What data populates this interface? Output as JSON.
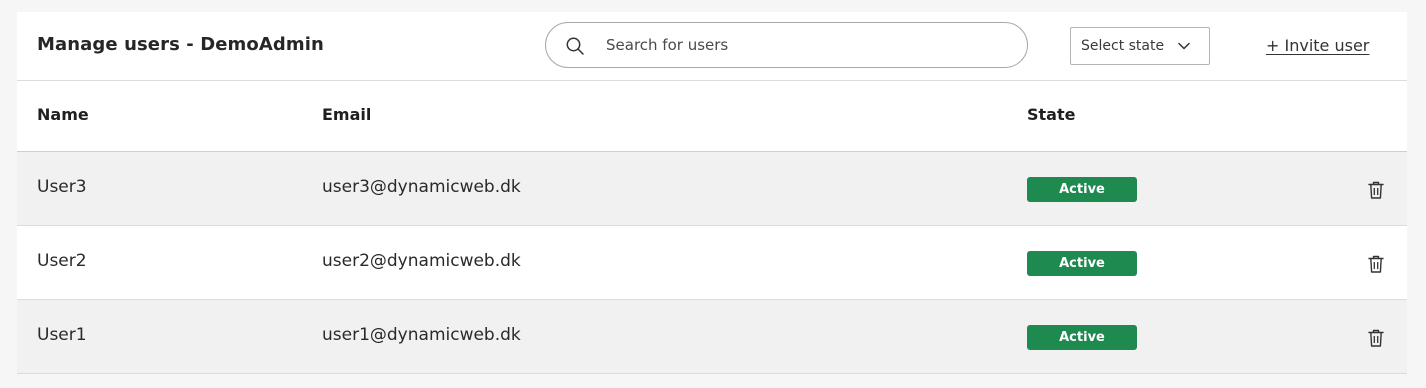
{
  "header": {
    "title": "Manage users - DemoAdmin",
    "search": {
      "placeholder": "Search for users",
      "value": ""
    },
    "state_select": {
      "label": "Select state"
    },
    "invite_label": "+ Invite user"
  },
  "table": {
    "columns": [
      "Name",
      "Email",
      "State"
    ],
    "rows": [
      {
        "name": "User3",
        "email": "user3@dynamicweb.dk",
        "state": "Active"
      },
      {
        "name": "User2",
        "email": "user2@dynamicweb.dk",
        "state": "Active"
      },
      {
        "name": "User1",
        "email": "user1@dynamicweb.dk",
        "state": "Active"
      }
    ]
  },
  "colors": {
    "active_badge": "#1e8a50",
    "row_shade": "#f1f1f1",
    "background": "#f6f6f6"
  },
  "icons": {
    "search": "search-icon",
    "select_chevron": "chevron-down-icon",
    "row_delete": "trash-icon"
  }
}
